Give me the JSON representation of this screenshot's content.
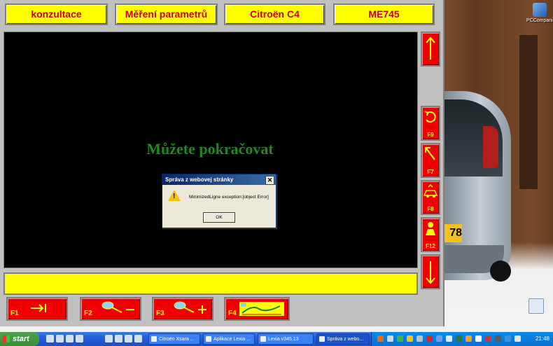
{
  "app": {
    "tabs": [
      "konzultace",
      "Měření parametrů",
      "Citroën C4",
      "ME745"
    ],
    "message": "Můžete pokračovat",
    "side_keys": [
      "F9",
      "F7",
      "F8",
      "F12"
    ],
    "function_keys": [
      "F1",
      "F2",
      "F3",
      "F4"
    ],
    "colors": {
      "accent": "#ee0000",
      "tab_bg": "#ffff00",
      "tab_text": "#cc0000",
      "message": "#1f8a1f"
    }
  },
  "dialog": {
    "title": "Správa z webovej stránky",
    "text": "MinimizedLigne exception:[object Error]",
    "ok_label": "OK"
  },
  "desktop": {
    "icons": [
      {
        "name": "PCCompani..."
      }
    ],
    "car_plate": "78"
  },
  "taskbar": {
    "start_label": "start",
    "items": [
      "Citroën Xsara ...",
      "Aplikace Lexia ...",
      "Lexia v345.13",
      "Správa z webo..."
    ],
    "clock": "21:48"
  }
}
